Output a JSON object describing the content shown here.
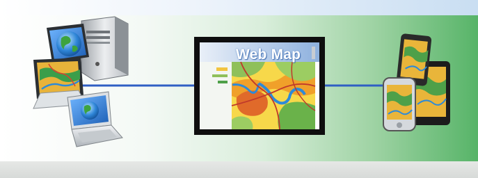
{
  "web_map": {
    "title": "Web Map"
  },
  "colors": {
    "connector": "#2f5fc4",
    "frame": "#0e0e0e",
    "background_right": "#57b468"
  },
  "icons": [
    "desktop-computer-icon",
    "laptop-icon",
    "globe-icon",
    "tablet-icon",
    "smartphone-icon",
    "map-icon"
  ]
}
